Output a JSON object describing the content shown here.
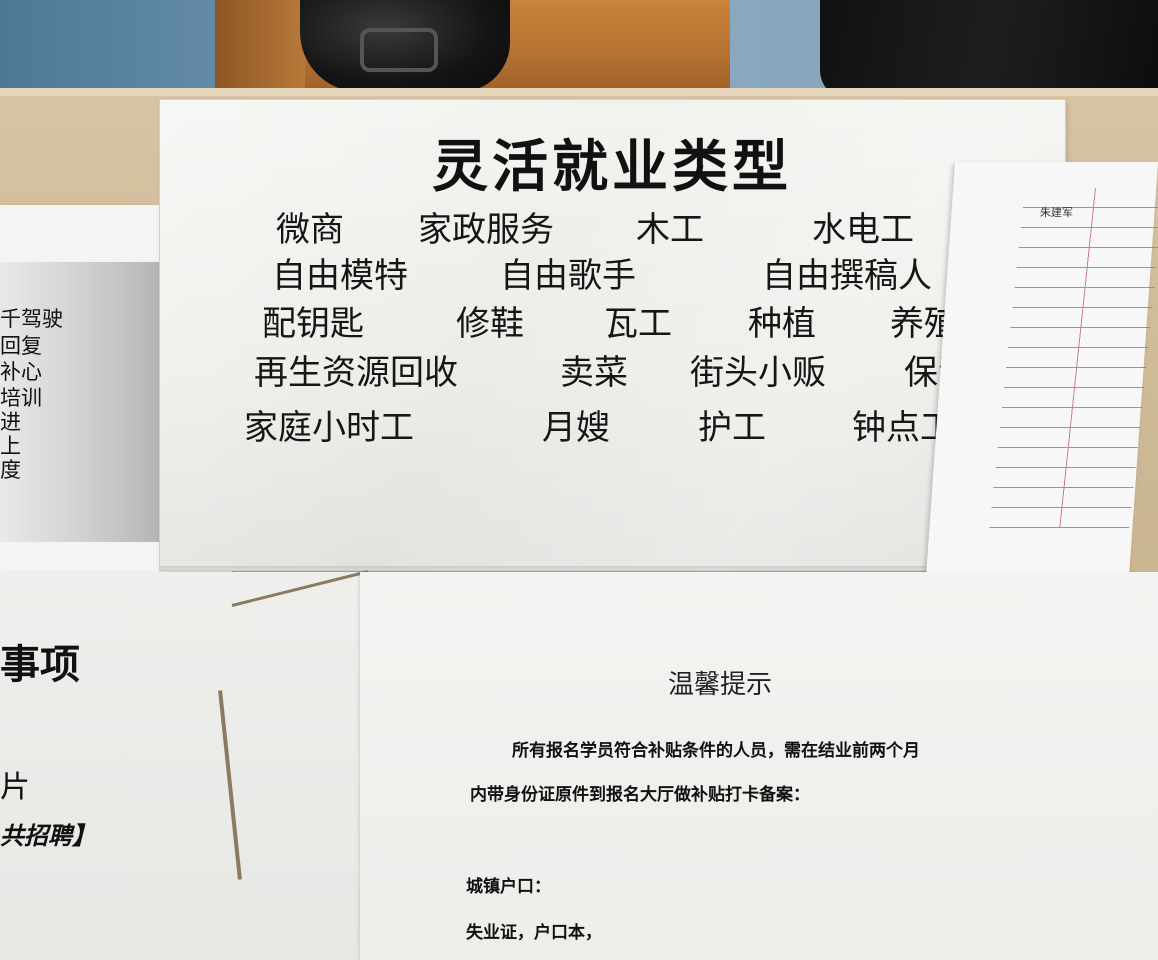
{
  "main_poster": {
    "title": "灵活就业类型",
    "jobs": [
      "微商",
      "家政服务",
      "木工",
      "水电工",
      "自由模特",
      "自由歌手",
      "自由撰稿人",
      "配钥匙",
      "修鞋",
      "瓦工",
      "种植",
      "养殖",
      "再生资源回收",
      "卖菜",
      "街头小贩",
      "保洁",
      "家庭小时工",
      "月嫂",
      "护工",
      "钟点工"
    ]
  },
  "left_poster": {
    "lines": [
      "千驾驶",
      "回复",
      "补心",
      "培训",
      "进",
      "上",
      "度"
    ]
  },
  "lower_left_sheet": {
    "heading_fragment": "事项",
    "line1_fragment": "片",
    "line2_fragment": "共招聘】"
  },
  "notice": {
    "title": "温馨提示",
    "line1": "所有报名学员符合补贴条件的人员，需在结业前两个月",
    "line2": "内带身份证原件到报名大厅做补贴打卡备案：",
    "line3": "城镇户口：",
    "line4": "失业证，户口本，"
  },
  "form_stack": {
    "handwritten_note": "朱建军"
  }
}
